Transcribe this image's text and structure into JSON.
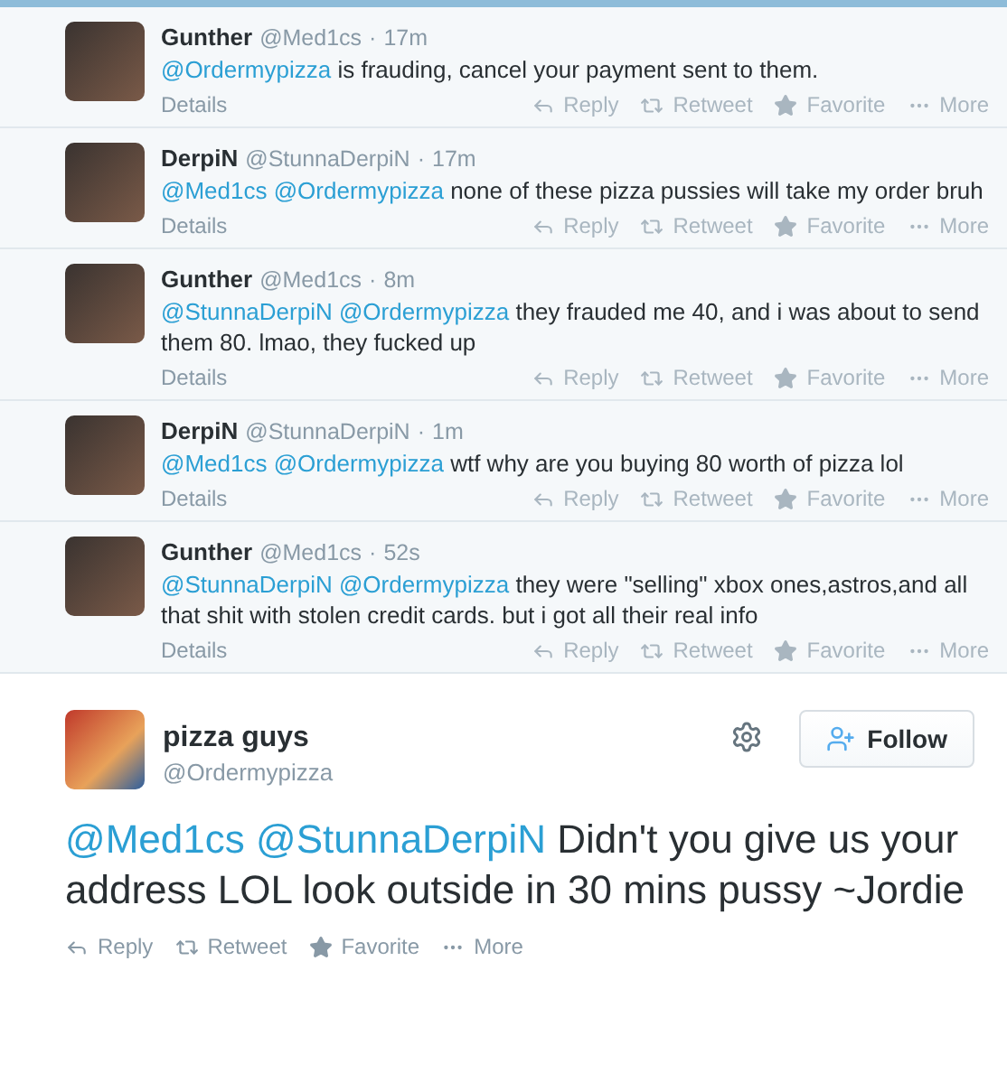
{
  "replies": [
    {
      "name": "Gunther",
      "handle": "@Med1cs",
      "separator": "·",
      "time": "17m",
      "mentions": [
        "@Ordermypizza"
      ],
      "text": "is frauding, cancel your payment sent to them.",
      "details": "Details",
      "actions": [
        {
          "kind": "reply",
          "label": "Reply"
        },
        {
          "kind": "retweet",
          "label": "Retweet"
        },
        {
          "kind": "favorite",
          "label": "Favorite"
        },
        {
          "kind": "more",
          "label": "More"
        }
      ]
    },
    {
      "name": "DerpiN",
      "handle": "@StunnaDerpiN",
      "separator": "·",
      "time": "17m",
      "mentions": [
        "@Med1cs",
        "@Ordermypizza"
      ],
      "text": "none of these pizza pussies will take my order bruh",
      "details": "Details",
      "actions": [
        {
          "kind": "reply",
          "label": "Reply"
        },
        {
          "kind": "retweet",
          "label": "Retweet"
        },
        {
          "kind": "favorite",
          "label": "Favorite"
        },
        {
          "kind": "more",
          "label": "More"
        }
      ]
    },
    {
      "name": "Gunther",
      "handle": "@Med1cs",
      "separator": "·",
      "time": "8m",
      "mentions": [
        "@StunnaDerpiN",
        "@Ordermypizza"
      ],
      "text": "they frauded me 40, and i was about to send them 80. lmao, they fucked up",
      "details": "Details",
      "actions": [
        {
          "kind": "reply",
          "label": "Reply"
        },
        {
          "kind": "retweet",
          "label": "Retweet"
        },
        {
          "kind": "favorite",
          "label": "Favorite"
        },
        {
          "kind": "more",
          "label": "More"
        }
      ]
    },
    {
      "name": "DerpiN",
      "handle": "@StunnaDerpiN",
      "separator": "·",
      "time": "1m",
      "mentions": [
        "@Med1cs",
        "@Ordermypizza"
      ],
      "text": "wtf why are you buying 80 worth of pizza lol",
      "details": "Details",
      "actions": [
        {
          "kind": "reply",
          "label": "Reply"
        },
        {
          "kind": "retweet",
          "label": "Retweet"
        },
        {
          "kind": "favorite",
          "label": "Favorite"
        },
        {
          "kind": "more",
          "label": "More"
        }
      ]
    },
    {
      "name": "Gunther",
      "handle": "@Med1cs",
      "separator": "·",
      "time": "52s",
      "mentions": [
        "@StunnaDerpiN",
        "@Ordermypizza"
      ],
      "text": "they were \"selling\" xbox ones,astros,and all that shit with stolen credit cards. but i got all their real info",
      "details": "Details",
      "actions": [
        {
          "kind": "reply",
          "label": "Reply"
        },
        {
          "kind": "retweet",
          "label": "Retweet"
        },
        {
          "kind": "favorite",
          "label": "Favorite"
        },
        {
          "kind": "more",
          "label": "More"
        }
      ]
    }
  ],
  "main_tweet": {
    "name": "pizza guys",
    "handle": "@Ordermypizza",
    "follow_button": "Follow",
    "mentions": [
      "@Med1cs",
      "@StunnaDerpiN"
    ],
    "text": "Didn't you give us your address LOL look outside in 30 mins pussy ~Jordie",
    "actions": [
      {
        "kind": "reply",
        "label": "Reply"
      },
      {
        "kind": "retweet",
        "label": "Retweet"
      },
      {
        "kind": "favorite",
        "label": "Favorite"
      },
      {
        "kind": "more",
        "label": "More"
      }
    ]
  }
}
